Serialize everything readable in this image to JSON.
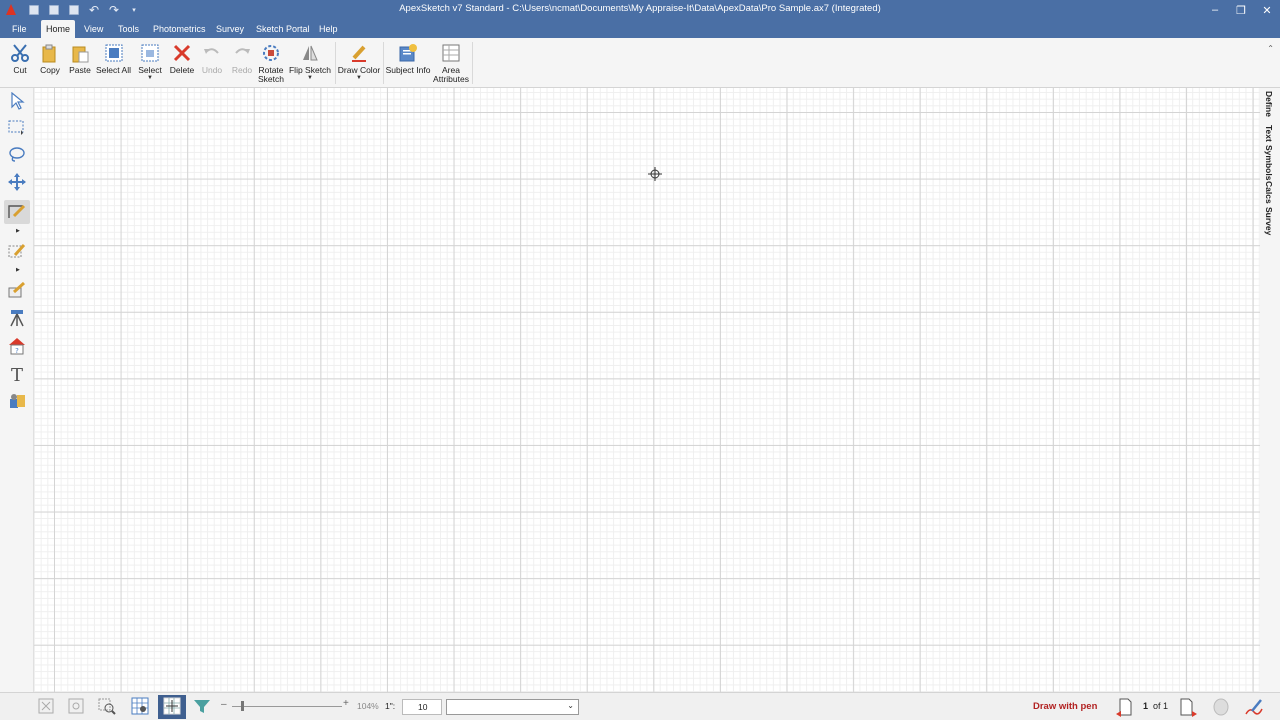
{
  "window": {
    "title": "ApexSketch v7 Standard - C:\\Users\\ncmat\\Documents\\My Appraise-It\\Data\\ApexData\\Pro Sample.ax7 (Integrated)",
    "controls": {
      "minimize": "–",
      "restore": "❐",
      "close": "✕"
    }
  },
  "menu": {
    "tabs": [
      "File",
      "Home",
      "View",
      "Tools",
      "Photometrics",
      "Survey",
      "Sketch Portal",
      "Help"
    ],
    "active_tab": "Home"
  },
  "ribbon": {
    "buttons": [
      {
        "label": "Cut",
        "icon": "scissors-icon"
      },
      {
        "label": "Copy",
        "icon": "copy-icon"
      },
      {
        "label": "Paste",
        "icon": "paste-icon"
      },
      {
        "label": "Select All",
        "icon": "select-all-icon"
      },
      {
        "label": "Select",
        "icon": "select-icon",
        "dropdown": true
      },
      {
        "label": "Delete",
        "icon": "delete-icon"
      },
      {
        "label": "Undo",
        "icon": "undo-icon",
        "disabled": true
      },
      {
        "label": "Redo",
        "icon": "redo-icon",
        "disabled": true
      },
      {
        "label": "Rotate Sketch",
        "icon": "rotate-sketch-icon"
      },
      {
        "label": "Flip Sketch",
        "icon": "flip-sketch-icon",
        "dropdown": true
      },
      {
        "label": "Draw Color",
        "icon": "draw-color-icon",
        "dropdown": true
      },
      {
        "label": "Subject Info",
        "icon": "subject-info-icon"
      },
      {
        "label": "Area Attributes",
        "icon": "area-attributes-icon"
      }
    ]
  },
  "left_toolbar": {
    "tools": [
      "pointer-icon",
      "rectangle-select-icon",
      "lasso-icon",
      "move-icon",
      "draw-pen-icon",
      "area-tool-icon",
      "edit-shape-icon",
      "survey-tripod-icon",
      "house-icon",
      "text-tool-icon",
      "symbols-icon"
    ],
    "active_tool": "draw-pen-icon"
  },
  "side_tabs": [
    "Define",
    "Text",
    "Symbols",
    "Calcs",
    "Survey"
  ],
  "status": {
    "zoom": "104%",
    "scale_label": "1\":",
    "scale_value": "10",
    "dropdown_value": "",
    "mode": "Draw with pen",
    "page_current": "1",
    "page_of": "of 1"
  },
  "colors": {
    "titlebar": "#4a6fa5",
    "ribbon_bg": "#f5f5f5",
    "mode_text": "#b22222",
    "active_status_btn": "#3f5f8f"
  }
}
